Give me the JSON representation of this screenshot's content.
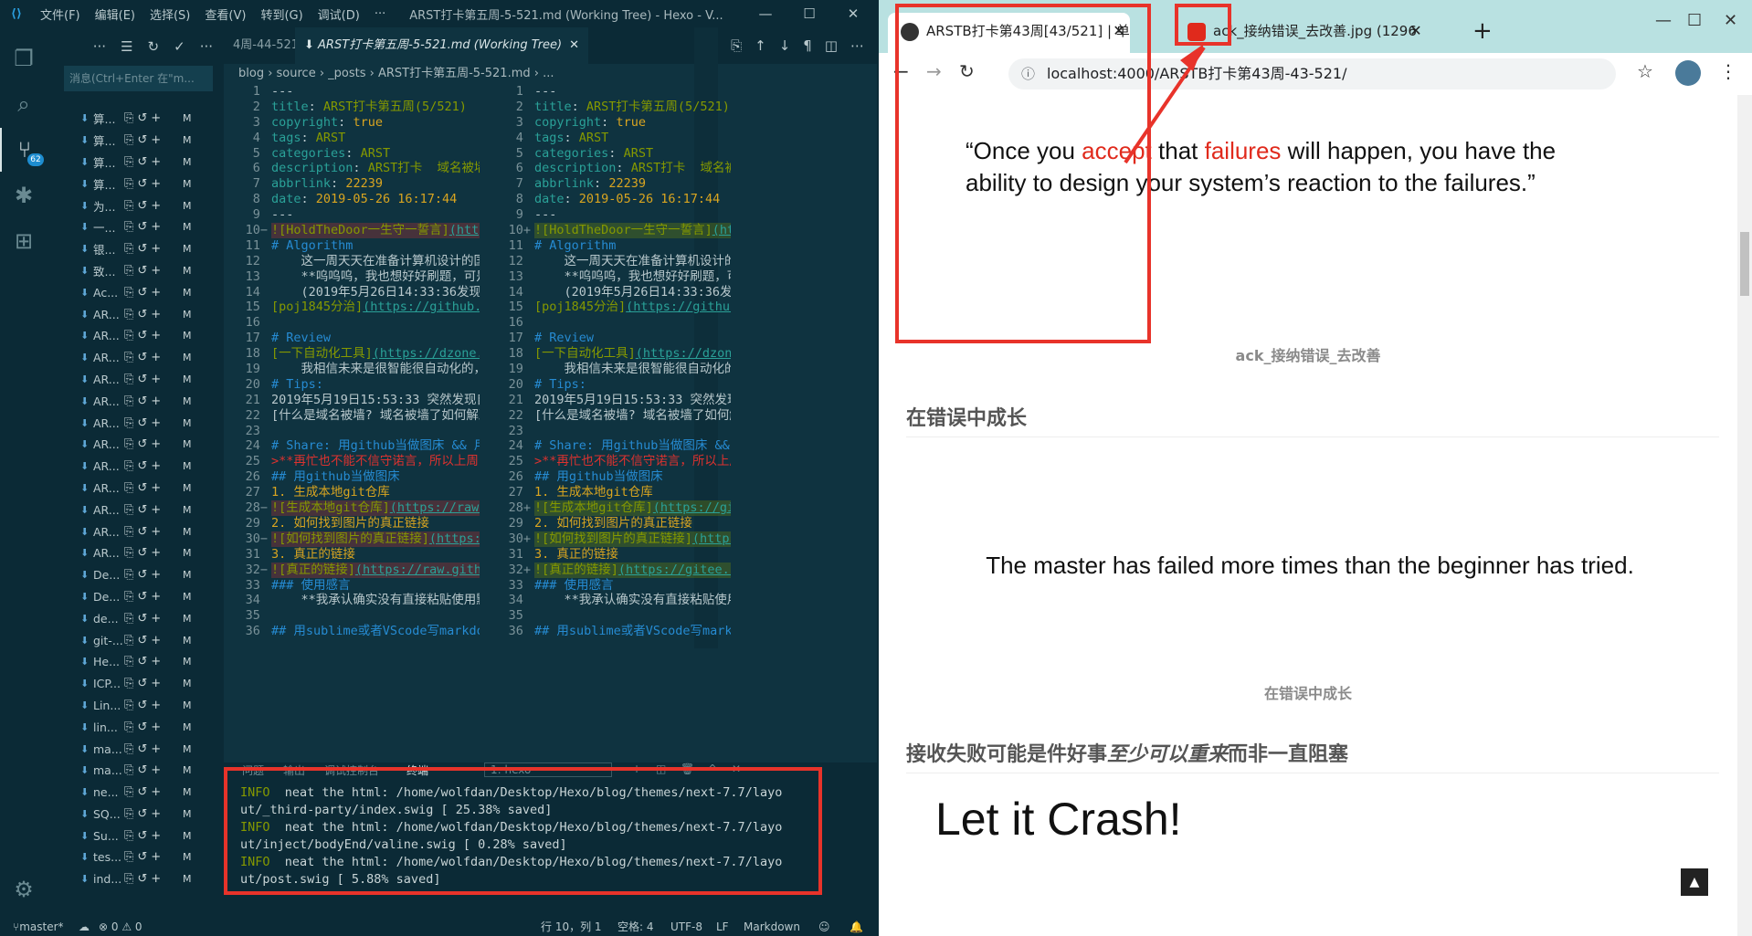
{
  "vscode": {
    "menus": [
      "文件(F)",
      "编辑(E)",
      "选择(S)",
      "查看(V)",
      "转到(G)",
      "调试(D)",
      "···"
    ],
    "window_title": "ARST打卡第五周-5-521.md (Working Tree) - Hexo - V...",
    "activity_badge": "62",
    "commit_placeholder": "消息(Ctrl+Enter 在\"m...",
    "scm_files": [
      "算...",
      "算...",
      "算...",
      "算...",
      "为...",
      "一...",
      "银...",
      "致...",
      "Ac...",
      "AR...",
      "AR...",
      "AR...",
      "AR...",
      "AR...",
      "AR...",
      "AR...",
      "AR...",
      "AR...",
      "AR...",
      "AR...",
      "AR...",
      "De...",
      "De...",
      "de...",
      "git-...",
      "He...",
      "ICP...",
      "Lin...",
      "lin...",
      "ma...",
      "ma...",
      "ne...",
      "SQ...",
      "Su...",
      "tes...",
      "ind..."
    ],
    "scm_status": "M",
    "tabs": [
      {
        "label": "4周-44-521.md"
      },
      {
        "label": "ARST打卡第五周-5-521.md (Working Tree)"
      }
    ],
    "breadcrumb": "blog › source › _posts › ARST打卡第五周-5-521.md › ...",
    "left_lines": [
      "---",
      "title: ARST打卡第五周(5/521)",
      "copyright: true",
      "tags: ARST",
      "categories: ARST",
      "description: ARST打卡  域名被墙了如",
      "abbrlink: 22239",
      "date: 2019-05-26 16:17:44",
      "---",
      "![HoldTheDoor一生守一誓言](https:",
      "# Algorithm",
      "    这一周天天在准备计算机设计的国赛",
      "    **呜呜呜，我也想好好刷题，可是时",
      "    (2019年5月26日14:33:36发现昨天",
      "[poj1845分治](https://github.co",
      "",
      "# Review",
      "[一下自动化工具](https://dzone.co",
      "    我相信未来是很智能很自动化的，我",
      "# Tips:",
      "2019年5月19日15:53:33 突然发现自己",
      "[什么是域名被墙? 域名被墙了如何解决?",
      "",
      "# Share: 用github当做图床 && 用su",
      ">**再忙也不能不信守诺言，所以上周blo",
      "## 用github当做图床",
      "1. 生成本地git仓库",
      "![生成本地git仓库](https://raw.gi",
      "2. 如何找到图片的真正链接",
      "![如何找到图片的真正链接](https://",
      "3. 真正的链接",
      "![真正的链接](https://raw.githubu",
      "### 使用感言",
      "    **我承认确实没有直接粘贴使用默认",
      "",
      "## 用sublime或者VScode写markdown"
    ],
    "right_lines": [
      "---",
      "title: ARST打卡第五周(5/521)",
      "copyright: true",
      "tags: ARST",
      "categories: ARST",
      "description: ARST打卡  域名被墙了如",
      "abbrlink: 22239",
      "date: 2019-05-26 16:17:44",
      "---",
      "![HoldTheDoor一生守一誓言](https",
      "# Algorithm",
      "    这一周天天在准备计算机设计的国赛",
      "    **呜呜呜，我也想好好刷题，可是时",
      "    (2019年5月26日14:33:36发现昨天",
      "[poj1845分治](https://github.co",
      "",
      "# Review",
      "[一下自动化工具](https://dzone.co",
      "    我相信未来是很智能很自动化的，我",
      "# Tips:",
      "2019年5月19日15:53:33 突然发现自己",
      "[什么是域名被墙? 域名被墙了如何解决?",
      "",
      "# Share: 用github当做图床 && 用su",
      ">**再忙也不能不信守诺言，所以上周bl",
      "## 用github当做图床",
      "1. 生成本地git仓库",
      "![生成本地git仓库](https://gitee",
      "2. 如何找到图片的真正链接",
      "![如何找到图片的真正链接](https://",
      "3. 真正的链接",
      "![真正的链接](https://gitee.com/",
      "### 使用感言",
      "    **我承认确实没有直接粘贴使用默认",
      "",
      "## 用sublime或者VScode写markdown"
    ],
    "panel": {
      "tabs": [
        "问题",
        "输出",
        "调试控制台",
        "终端"
      ],
      "terminal_select": "1: hexo",
      "terminal_lines": [
        {
          "tag": "INFO",
          "text": "  neat the html: /home/wolfdan/Desktop/Hexo/blog/themes/next-7.7/layo"
        },
        {
          "tag": "",
          "text": "ut/_third-party/index.swig [ 25.38% saved]"
        },
        {
          "tag": "INFO",
          "text": "  neat the html: /home/wolfdan/Desktop/Hexo/blog/themes/next-7.7/layo"
        },
        {
          "tag": "",
          "text": "ut/inject/bodyEnd/valine.swig [ 0.28% saved]"
        },
        {
          "tag": "INFO",
          "text": "  neat the html: /home/wolfdan/Desktop/Hexo/blog/themes/next-7.7/layo"
        },
        {
          "tag": "",
          "text": "ut/post.swig [ 5.88% saved]"
        }
      ]
    },
    "status": {
      "branch": "master*",
      "problems": "⊗ 0 ⚠ 0",
      "position": "行 10，列 1",
      "spaces": "空格: 4",
      "encoding": "UTF-8",
      "eol": "LF",
      "language": "Markdown"
    }
  },
  "browser": {
    "tabs": [
      {
        "title": "ARSTB打卡第43周[43/521] | 单",
        "active": true
      },
      {
        "title": "ack_接纳错误_去改善.jpg (1296",
        "active": false
      }
    ],
    "url": "localhost:4000/ARSTB打卡第43周-43-521/",
    "page": {
      "quote_line1_parts": [
        "“Once you ",
        "accept",
        " that ",
        "failures",
        " will happen, you have the"
      ],
      "quote_line2": "ability to design your system’s reaction to the failures.”",
      "caption1": "ack_接纳错误_去改善",
      "heading1": "在错误中成长",
      "master_quote": "The master has failed more times than the beginner has tried.",
      "caption2": "在错误中成长",
      "heading2_parts": [
        "接收失败可能是件好事",
        "至少可以重来",
        "而非一直阻塞"
      ],
      "crash_text": "Let it Crash!"
    }
  },
  "colors": {
    "vscode_bg": "#0b2a36",
    "editor_bg": "#0f3340",
    "highlight_red": "#e8332a",
    "quote_accent": "#e02a1c",
    "chrome_tab_bar": "#b9e1e1"
  }
}
